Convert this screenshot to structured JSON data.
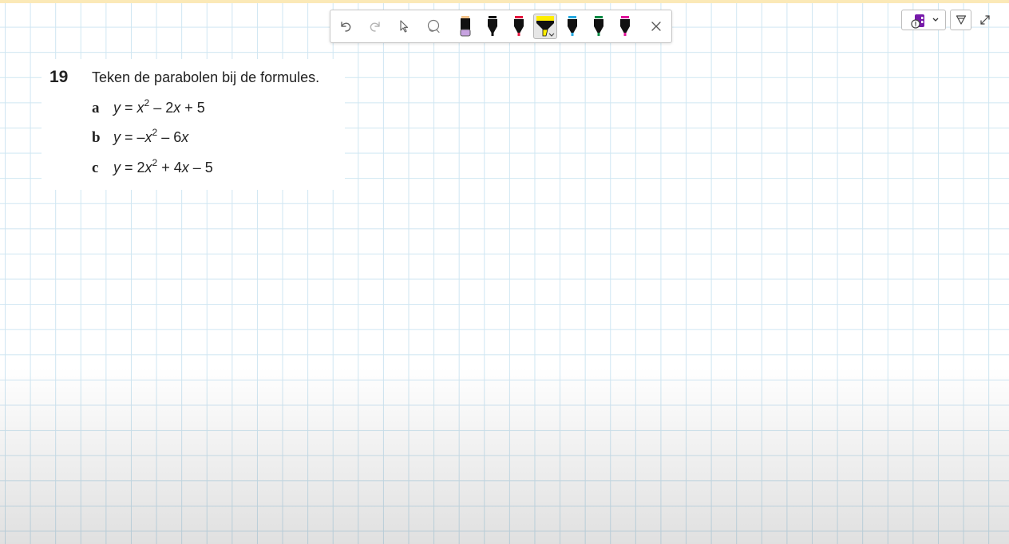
{
  "toolbar": {
    "tools": [
      {
        "name": "undo-button",
        "icon": "undo-icon"
      },
      {
        "name": "redo-button",
        "icon": "redo-icon"
      },
      {
        "name": "select-button",
        "icon": "pointer-icon"
      },
      {
        "name": "lasso-button",
        "icon": "lasso-icon"
      },
      {
        "name": "eraser-button",
        "icon": "eraser-icon"
      },
      {
        "name": "pen-black-button",
        "icon": "pen-icon",
        "color": "#111111"
      },
      {
        "name": "pen-red-button",
        "icon": "pen-icon",
        "color": "#e5173f"
      },
      {
        "name": "highlighter-yellow-button",
        "icon": "highlighter-icon",
        "color": "#ffee00",
        "selected": true
      },
      {
        "name": "pen-blue-button",
        "icon": "pen-icon",
        "color": "#27a9e1"
      },
      {
        "name": "pen-green-button",
        "icon": "pen-icon",
        "color": "#0e8a45"
      },
      {
        "name": "pen-magenta-button",
        "icon": "pen-icon",
        "color": "#e0149a"
      },
      {
        "name": "close-button",
        "icon": "close-icon"
      }
    ]
  },
  "top_right": {
    "notebook_icon": "onenote-icon",
    "filter_icon": "filter-icon",
    "expand_icon": "expand-icon"
  },
  "exercise": {
    "number": "19",
    "title": "Teken de parabolen bij de formules.",
    "items": [
      {
        "letter": "a",
        "parts": [
          "y",
          " = ",
          "x",
          "2",
          " – 2",
          "x",
          " + 5"
        ]
      },
      {
        "letter": "b",
        "parts": [
          "y",
          " = –",
          "x",
          "2",
          " – 6",
          "x"
        ]
      },
      {
        "letter": "c",
        "parts": [
          "y",
          " = 2",
          "x",
          "2",
          " + 4",
          "x",
          " – 5"
        ]
      }
    ]
  },
  "colors": {
    "grid_line": "#cfe6f2",
    "top_strip": "#fbe9b7"
  }
}
